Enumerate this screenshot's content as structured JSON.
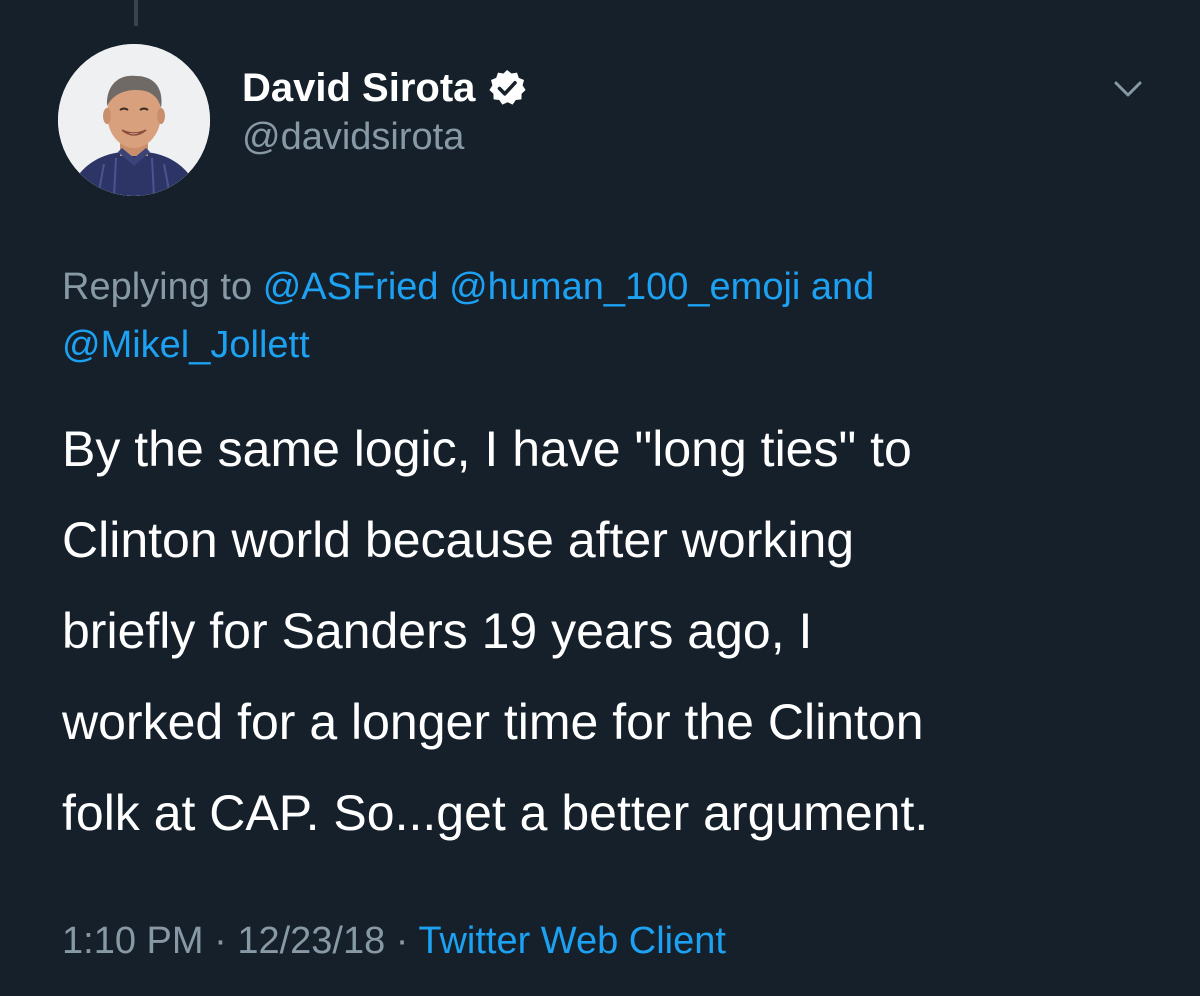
{
  "tweet": {
    "author": {
      "display_name": "David Sirota",
      "handle": "@davidsirota",
      "verified_icon": "verified-badge-icon"
    },
    "menu_icon": "chevron-down-icon",
    "replying": {
      "prefix": "Replying to",
      "mentions": [
        "@ASFried",
        "@human_100_emoji",
        "@Mikel_Jollett"
      ],
      "conjunction": "and"
    },
    "text_lines": [
      "By the same logic, I have \"long ties\" to",
      "Clinton world because after working",
      "briefly for Sanders 19 years ago, I",
      "worked for a longer time for the Clinton",
      "folk at CAP. So...get a better argument."
    ],
    "time": "1:10 PM",
    "separator": "·",
    "date": "12/23/18",
    "source": "Twitter Web Client"
  },
  "colors": {
    "background": "#15202b",
    "primary_text": "#ffffff",
    "secondary_text": "#8899a6",
    "link": "#1da1f2",
    "thread_line": "#38444d"
  }
}
